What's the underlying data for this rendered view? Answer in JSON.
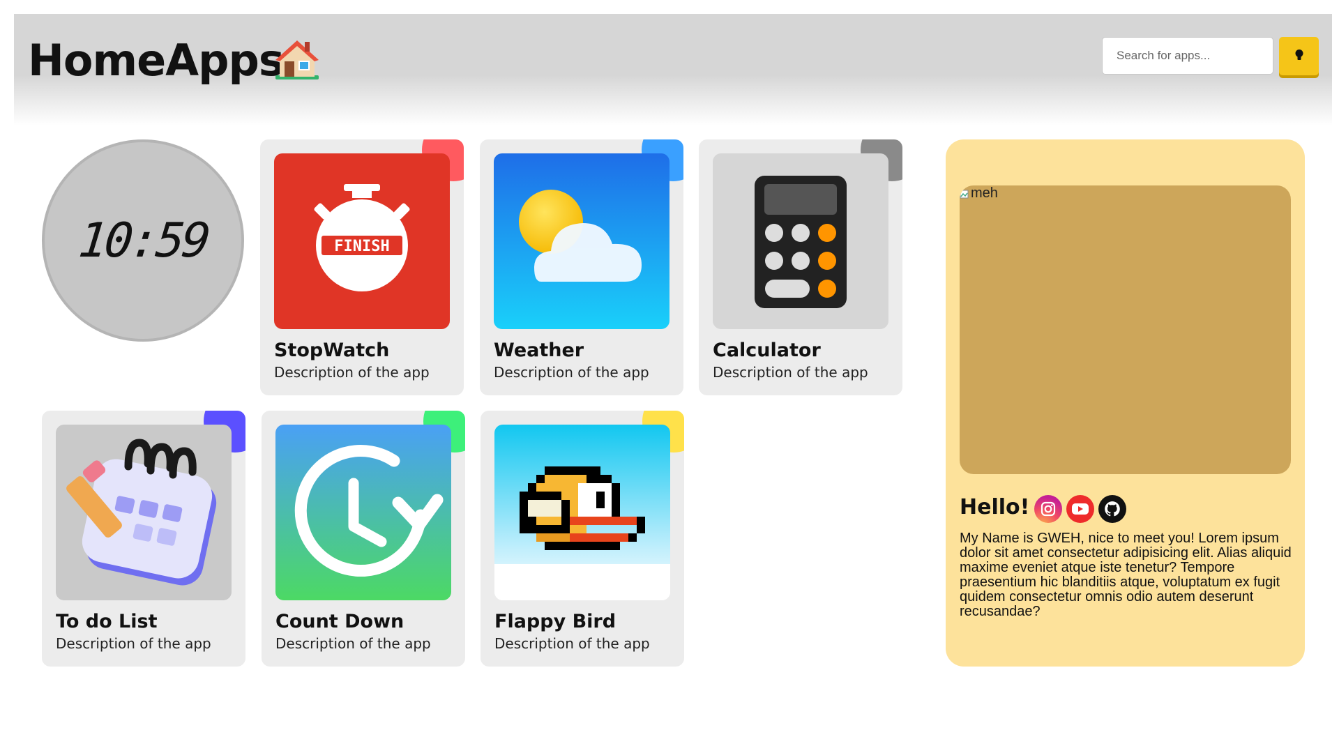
{
  "header": {
    "title": "HomeApps",
    "title_icon": "house-icon",
    "search_placeholder": "Search for apps...",
    "theme_button_icon": "lightbulb-icon",
    "accent_color": "#f5c518"
  },
  "clock": {
    "time": "10:59"
  },
  "apps": [
    {
      "name": "StopWatch",
      "description": "Description of the app",
      "icon": "stopwatch-icon",
      "badge_text": "FINISH",
      "corner_color": "#ff5a5f"
    },
    {
      "name": "Weather",
      "description": "Description of the app",
      "icon": "weather-icon",
      "corner_color": "#3aa0ff"
    },
    {
      "name": "Calculator",
      "description": "Description of the app",
      "icon": "calculator-icon",
      "corner_color": "#8a8a8a"
    },
    {
      "name": "To do List",
      "description": "Description of the app",
      "icon": "todo-calendar-icon",
      "corner_color": "#5b50ff"
    },
    {
      "name": "Count Down",
      "description": "Description of the app",
      "icon": "countdown-clock-icon",
      "corner_color": "#3df07a"
    },
    {
      "name": "Flappy Bird",
      "description": "Description of the app",
      "icon": "flappy-bird-icon",
      "corner_color": "#ffe14a"
    }
  ],
  "profile": {
    "image_alt": "meh",
    "greeting": "Hello!",
    "socials": [
      "instagram-icon",
      "youtube-icon",
      "github-icon"
    ],
    "bio": "My Name is GWEH, nice to meet you! Lorem ipsum dolor sit amet consectetur adipisicing elit. Alias aliquid maxime eveniet atque iste tenetur? Tempore praesentium hic blanditiis atque, voluptatum ex fugit quidem consectetur omnis odio autem deserunt recusandae?",
    "background_color": "#fde29b"
  }
}
